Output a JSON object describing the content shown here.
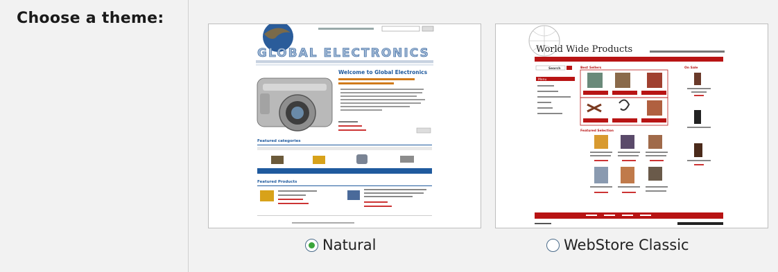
{
  "label": "Choose a theme:",
  "themes": [
    {
      "name": "Natural",
      "selected": true,
      "preview": {
        "logo": "GLOBAL ELECTRONICS",
        "welcome": "Welcome to Global Electronics",
        "featured_categories": "Featured categories",
        "featured_products": "Featured Products"
      }
    },
    {
      "name": "WebStore Classic",
      "selected": false,
      "preview": {
        "logo": "World Wide Products",
        "search_label": "Search",
        "menu_label": "Menu",
        "best_sellers": "Best Sellers",
        "featured_items": "Featured Selection",
        "on_sale": "On Sale"
      }
    }
  ],
  "colors": {
    "accent_green": "#3aa53a",
    "natural_blue": "#1f5a9e",
    "webstore_red": "#b81414"
  }
}
